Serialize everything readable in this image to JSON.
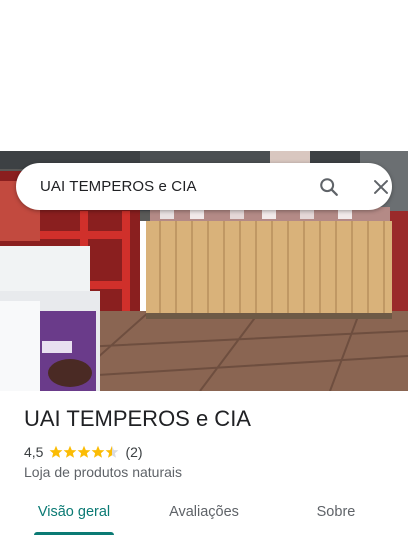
{
  "search": {
    "query": "UAI TEMPEROS e CIA",
    "search_icon": "search-icon",
    "close_icon": "close-icon"
  },
  "hero": {
    "photo": "storefront-photo"
  },
  "place": {
    "name": "UAI TEMPEROS e CIA",
    "rating": "4,5",
    "rating_value": 4.5,
    "stars_total": 5,
    "review_count": "(2)",
    "category": "Loja de produtos naturais"
  },
  "tabs": [
    {
      "label": "Visão geral",
      "active": true
    },
    {
      "label": "Avaliações",
      "active": false
    },
    {
      "label": "Sobre",
      "active": false
    }
  ],
  "colors": {
    "accent": "#0b7a74",
    "star": "#fbbc04",
    "star_empty": "#dadce0"
  }
}
